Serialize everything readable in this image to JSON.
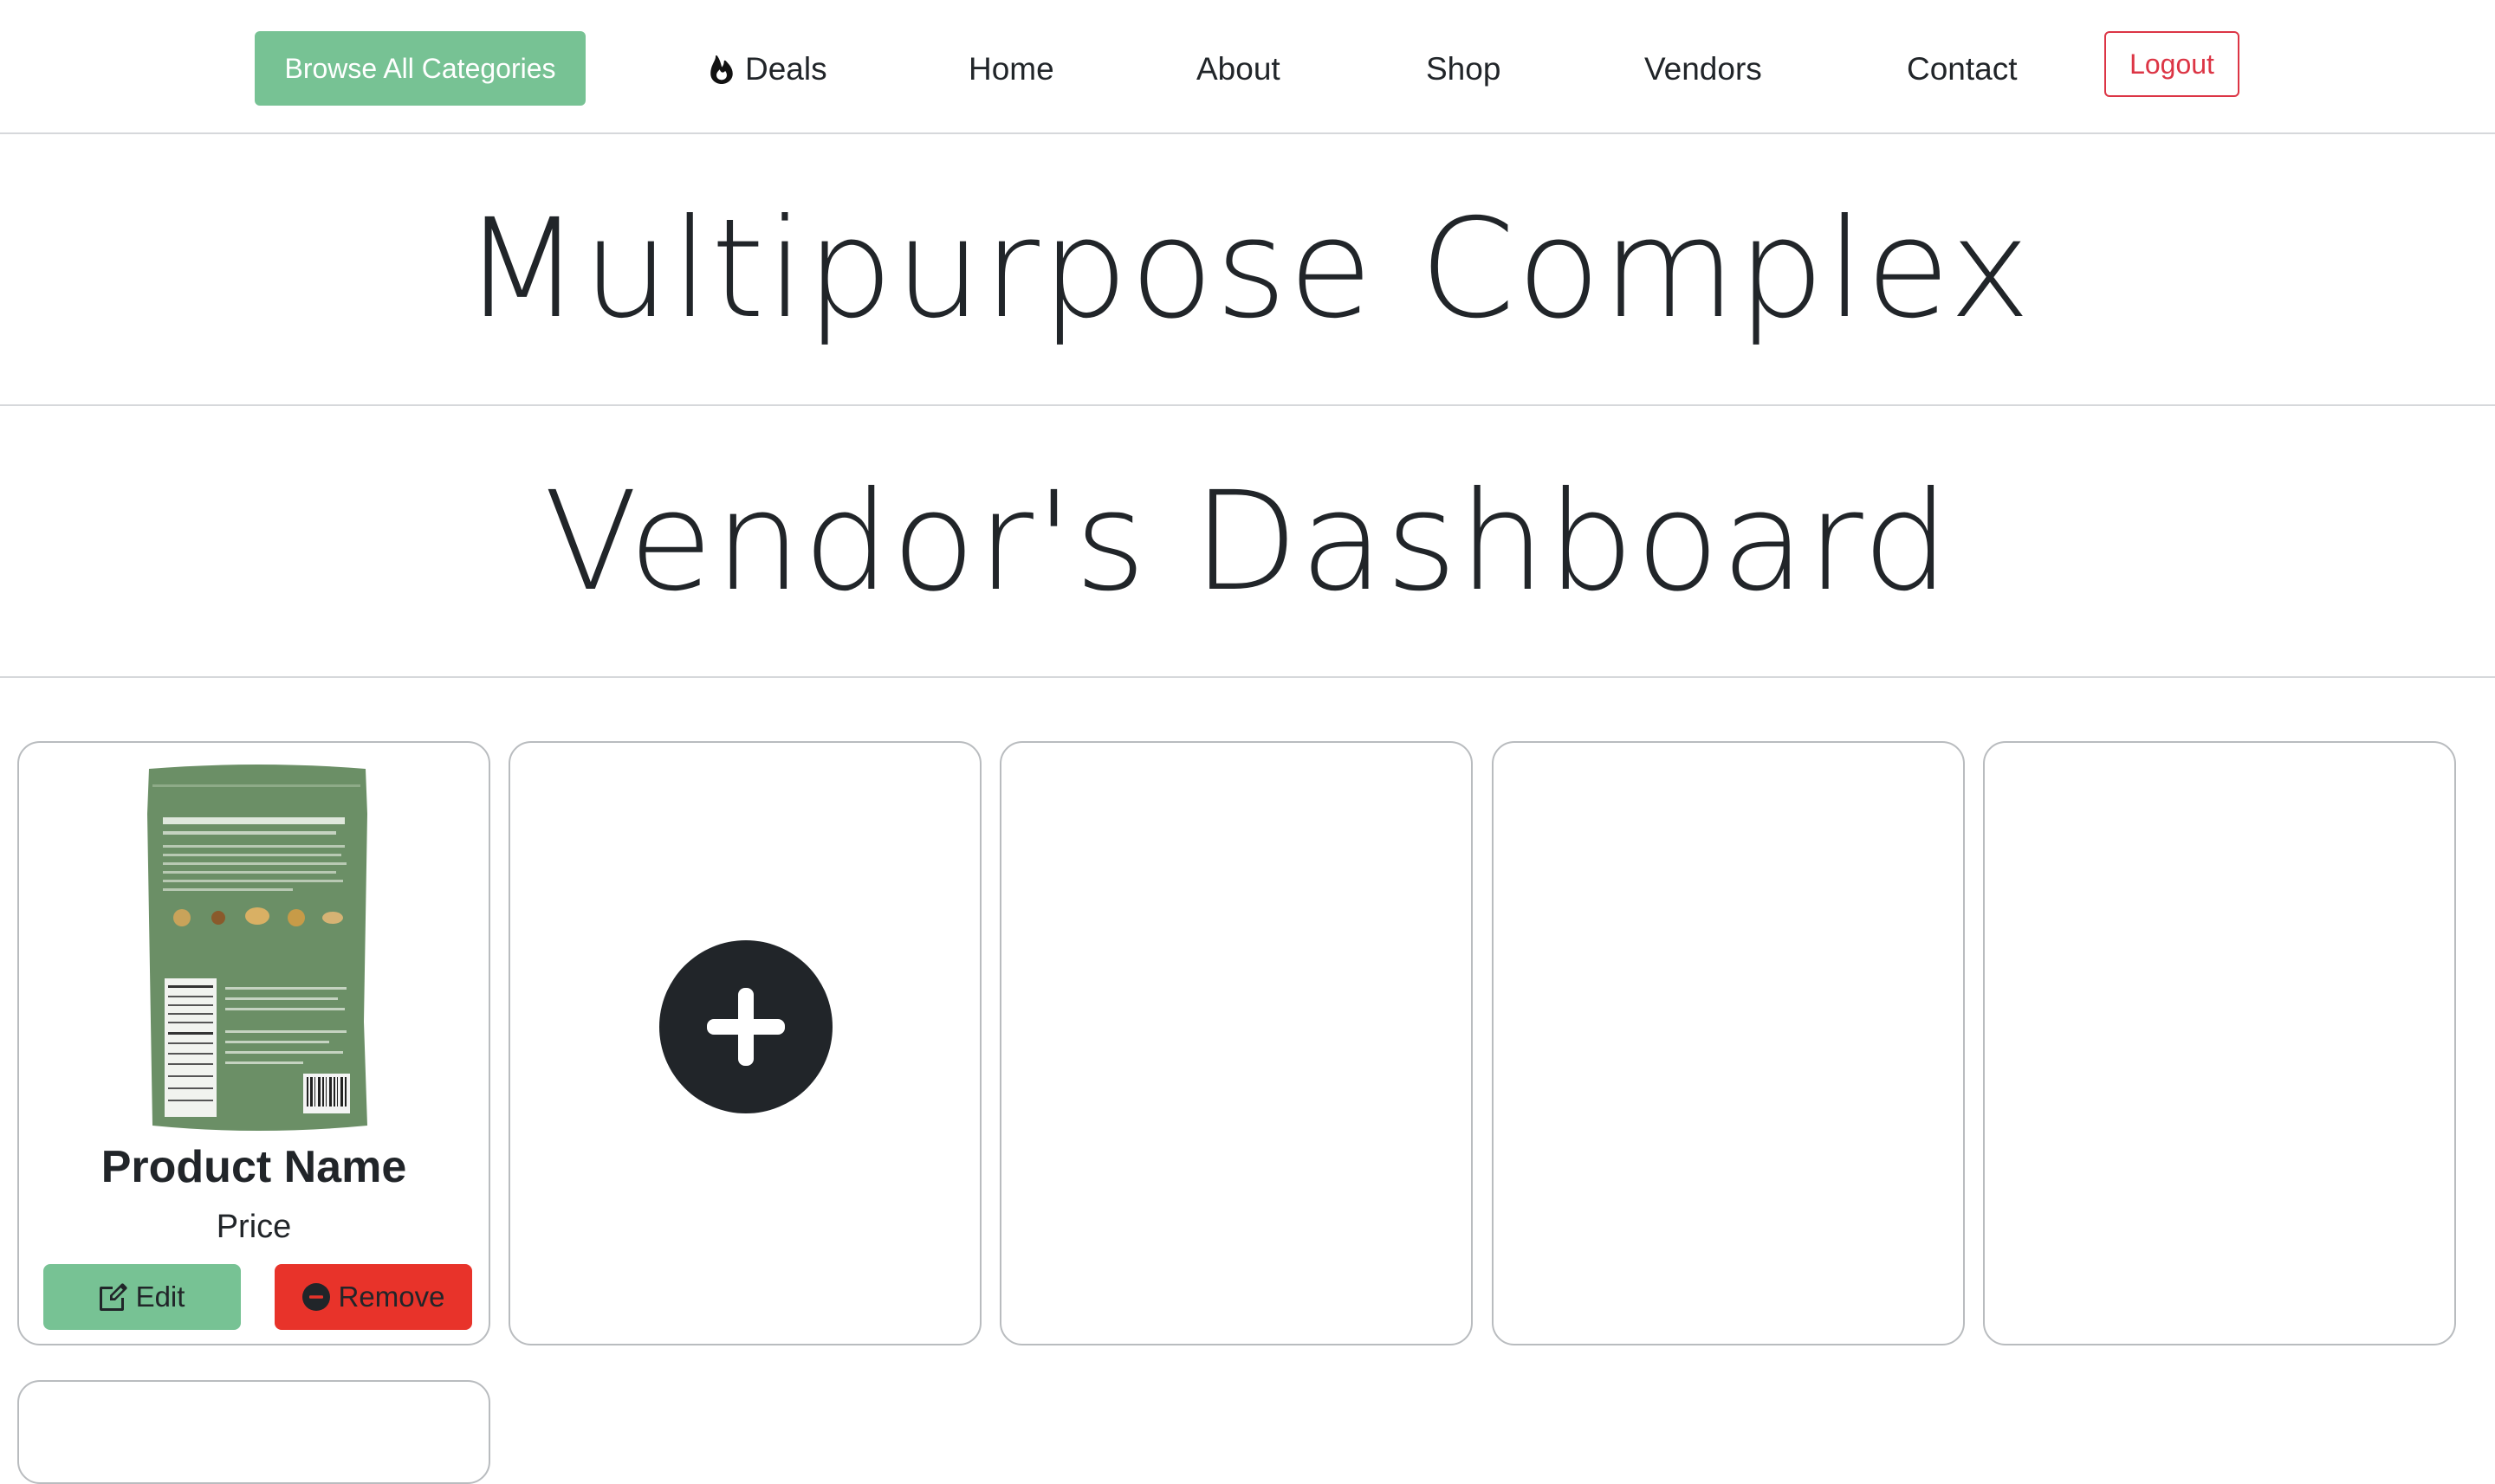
{
  "nav": {
    "browse_label": "Browse All Categories",
    "deals_label": "Deals",
    "home_label": "Home",
    "about_label": "About",
    "shop_label": "Shop",
    "vendors_label": "Vendors",
    "contact_label": "Contact",
    "logout_label": "Logout",
    "deals_icon": "fire-icon"
  },
  "headings": {
    "site_title": "Multipurpose Complex",
    "dashboard_title": "Vendor's Dashboard"
  },
  "product_card": {
    "name": "Product Name",
    "price": "Price",
    "edit_label": "Edit",
    "remove_label": "Remove",
    "edit_icon": "edit-icon",
    "remove_icon": "minus-circle-icon"
  },
  "add_card": {
    "icon": "plus-icon"
  },
  "colors": {
    "accent_green": "#77c294",
    "danger_red": "#e8332a",
    "logout_red": "#dc3545",
    "text_dark": "#212529",
    "product_bag_green": "#6b8f66"
  }
}
